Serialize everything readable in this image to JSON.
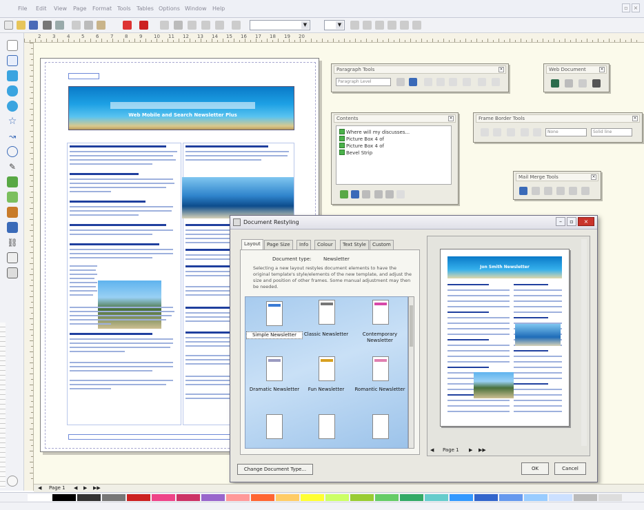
{
  "menubar": {
    "items": [
      "File",
      "Edit",
      "View",
      "Page",
      "Format",
      "Tools",
      "Tables",
      "Options",
      "Window",
      "Help"
    ]
  },
  "colors": {
    "workspace": "#fbfaeb",
    "accent": "#1f3f9e",
    "banner": "#1da0e4",
    "dialog_close": "#c9342c"
  },
  "toolbar": {
    "icons": [
      "new-icon",
      "open-icon",
      "save-icon",
      "print-icon",
      "preview-icon",
      "cut-icon",
      "copy-icon",
      "paste-icon",
      "undo-icon",
      "redo-icon",
      "insert-icon",
      "help-icon"
    ]
  },
  "ruler": {
    "labels": [
      "2",
      "3",
      "4",
      "5",
      "6",
      "7",
      "8",
      "9",
      "10",
      "11",
      "12",
      "13",
      "14",
      "15",
      "16",
      "17",
      "18",
      "19",
      "20"
    ]
  },
  "newsletter": {
    "banner_subtitle": "Web Mobile and Search Newsletter Plus"
  },
  "panels": {
    "paragraph_tools": {
      "title": "Paragraph Tools",
      "style_value": "Paragraph Level"
    },
    "contents": {
      "title": "Contents",
      "items": [
        "Where will my discusses...",
        "Picture Box 4 of",
        "Picture Box 4 of",
        "Bevel Strip"
      ]
    },
    "web_document": {
      "title": "Web Document"
    },
    "frame_border_tools": {
      "title": "Frame Border Tools",
      "field_a": "None",
      "field_b": "Solid line"
    },
    "mail_merge_tools": {
      "title": "Mail Merge Tools"
    }
  },
  "dialog": {
    "title": "Document Restyling",
    "tabs": [
      "Layout",
      "Page Size",
      "Info",
      "Colour",
      "Text Style",
      "Custom"
    ],
    "document_type_label": "Document type:",
    "document_type_value": "Newsletter",
    "description": "Selecting a new layout restyles document elements to have the original template's style/elements of the new template, and adjust the size and position of other frames. Some manual adjustment may then be needed.",
    "gallery": {
      "items": [
        {
          "label": "Simple Newsletter",
          "band": "#3a7bd5"
        },
        {
          "label": "Classic Newsletter",
          "band": "#777777"
        },
        {
          "label": "Contemporary Newsletter",
          "band": "#d848a8"
        },
        {
          "label": "Dramatic Newsletter",
          "band": "#9a9ac0"
        },
        {
          "label": "Fun Newsletter",
          "band": "#d8a020"
        },
        {
          "label": "Romantic Newsletter",
          "band": "#e080b0"
        }
      ]
    },
    "change_button": "Change Document Type...",
    "ok_button": "OK",
    "cancel_button": "Cancel",
    "preview": {
      "banner_text": "Jon Smith Newsletter",
      "page_label": "Page 1"
    }
  },
  "pagenav": {
    "page_label": "Page 1"
  },
  "palette": {
    "swatches": [
      "#ffffff",
      "#000000",
      "#333333",
      "#777777",
      "#cc2222",
      "#ee4488",
      "#cc3366",
      "#9966cc",
      "#ff9999",
      "#ff6633",
      "#ffcc66",
      "#ffff33",
      "#ccff66",
      "#99cc33",
      "#66cc66",
      "#33aa66",
      "#66cccc",
      "#3399ff",
      "#3366cc",
      "#6699ee",
      "#99ccff",
      "#cce0ff",
      "#bbbbbb",
      "#dddddd"
    ]
  }
}
